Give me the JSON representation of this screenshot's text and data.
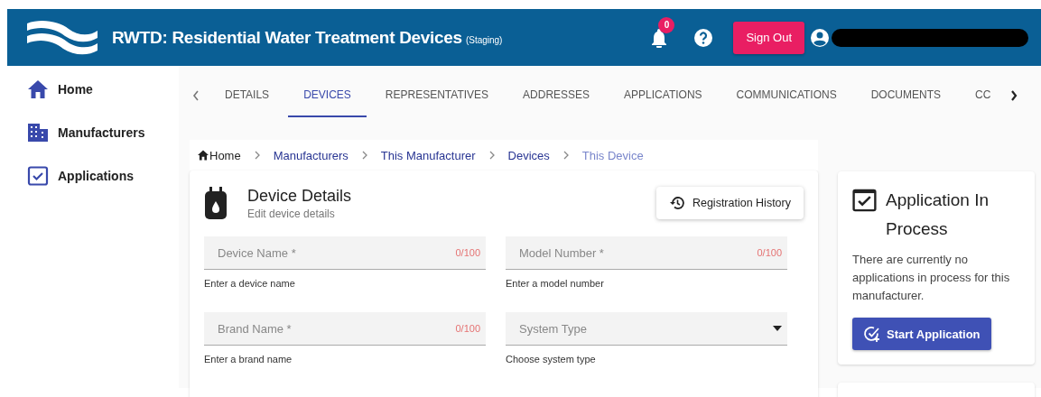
{
  "header": {
    "title": "RWTD: Residential Water Treatment Devices",
    "subtitle": "(Staging)",
    "notification_count": "0",
    "sign_out": "Sign Out"
  },
  "sidebar": {
    "items": [
      {
        "label": "Home",
        "selected": false
      },
      {
        "label": "Manufacturers",
        "selected": false
      },
      {
        "label": "Applications",
        "selected": false
      }
    ]
  },
  "tabs": [
    {
      "label": "DETAILS",
      "selected": false
    },
    {
      "label": "DEVICES",
      "selected": true
    },
    {
      "label": "REPRESENTATIVES",
      "selected": false
    },
    {
      "label": "ADDRESSES",
      "selected": false
    },
    {
      "label": "APPLICATIONS",
      "selected": false
    },
    {
      "label": "COMMUNICATIONS",
      "selected": false
    },
    {
      "label": "DOCUMENTS",
      "selected": false
    },
    {
      "label": "CC",
      "selected": false
    }
  ],
  "breadcrumb": [
    {
      "label": "Home",
      "kind": "home"
    },
    {
      "label": "Manufacturers",
      "kind": "link"
    },
    {
      "label": "This Manufacturer",
      "kind": "link"
    },
    {
      "label": "Devices",
      "kind": "link"
    },
    {
      "label": "This Device",
      "kind": "current"
    }
  ],
  "device_card": {
    "title": "Device Details",
    "subtitle": "Edit device details",
    "history_button": "Registration History",
    "fields": [
      {
        "kind": "text",
        "placeholder": "Device Name *",
        "counter": "0/100",
        "hint": "Enter a device name"
      },
      {
        "kind": "text",
        "placeholder": "Model Number *",
        "counter": "0/100",
        "hint": "Enter a model number"
      },
      {
        "kind": "text",
        "placeholder": "Brand Name *",
        "counter": "0/100",
        "hint": "Enter a brand name"
      },
      {
        "kind": "select",
        "placeholder": "System Type",
        "hint": "Choose system type"
      }
    ]
  },
  "application_card": {
    "title": "Application In Process",
    "message": "There are currently no applications in process for this manufacturer.",
    "button": "Start Application"
  }
}
